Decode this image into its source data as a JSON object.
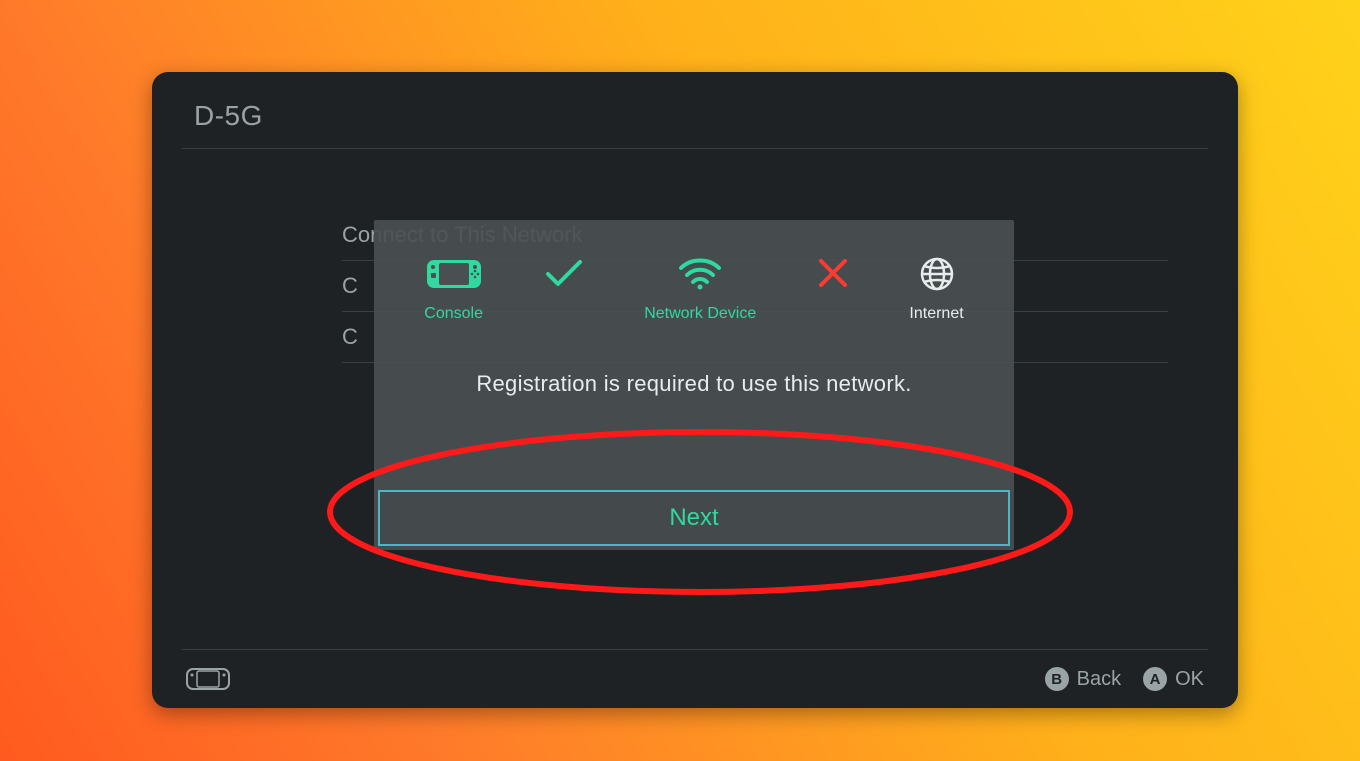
{
  "header": {
    "title": "D-5G"
  },
  "background_options": [
    "Connect to This Network",
    "C",
    "C"
  ],
  "dialog": {
    "status": {
      "console_label": "Console",
      "network_device_label": "Network Device",
      "internet_label": "Internet"
    },
    "message": "Registration is required to use this network.",
    "next_label": "Next"
  },
  "footer": {
    "back_glyph": "B",
    "back_label": "Back",
    "ok_glyph": "A",
    "ok_label": "OK"
  },
  "annotation": {
    "type": "ellipse-highlight",
    "color": "#ff1a1a"
  },
  "colors": {
    "accent_green": "#2fd9a0",
    "accent_cyan_border": "#4bb7c4",
    "error_red": "#ff3b30",
    "text_muted": "#9aa4a7",
    "panel_bg": "#1f2224"
  }
}
